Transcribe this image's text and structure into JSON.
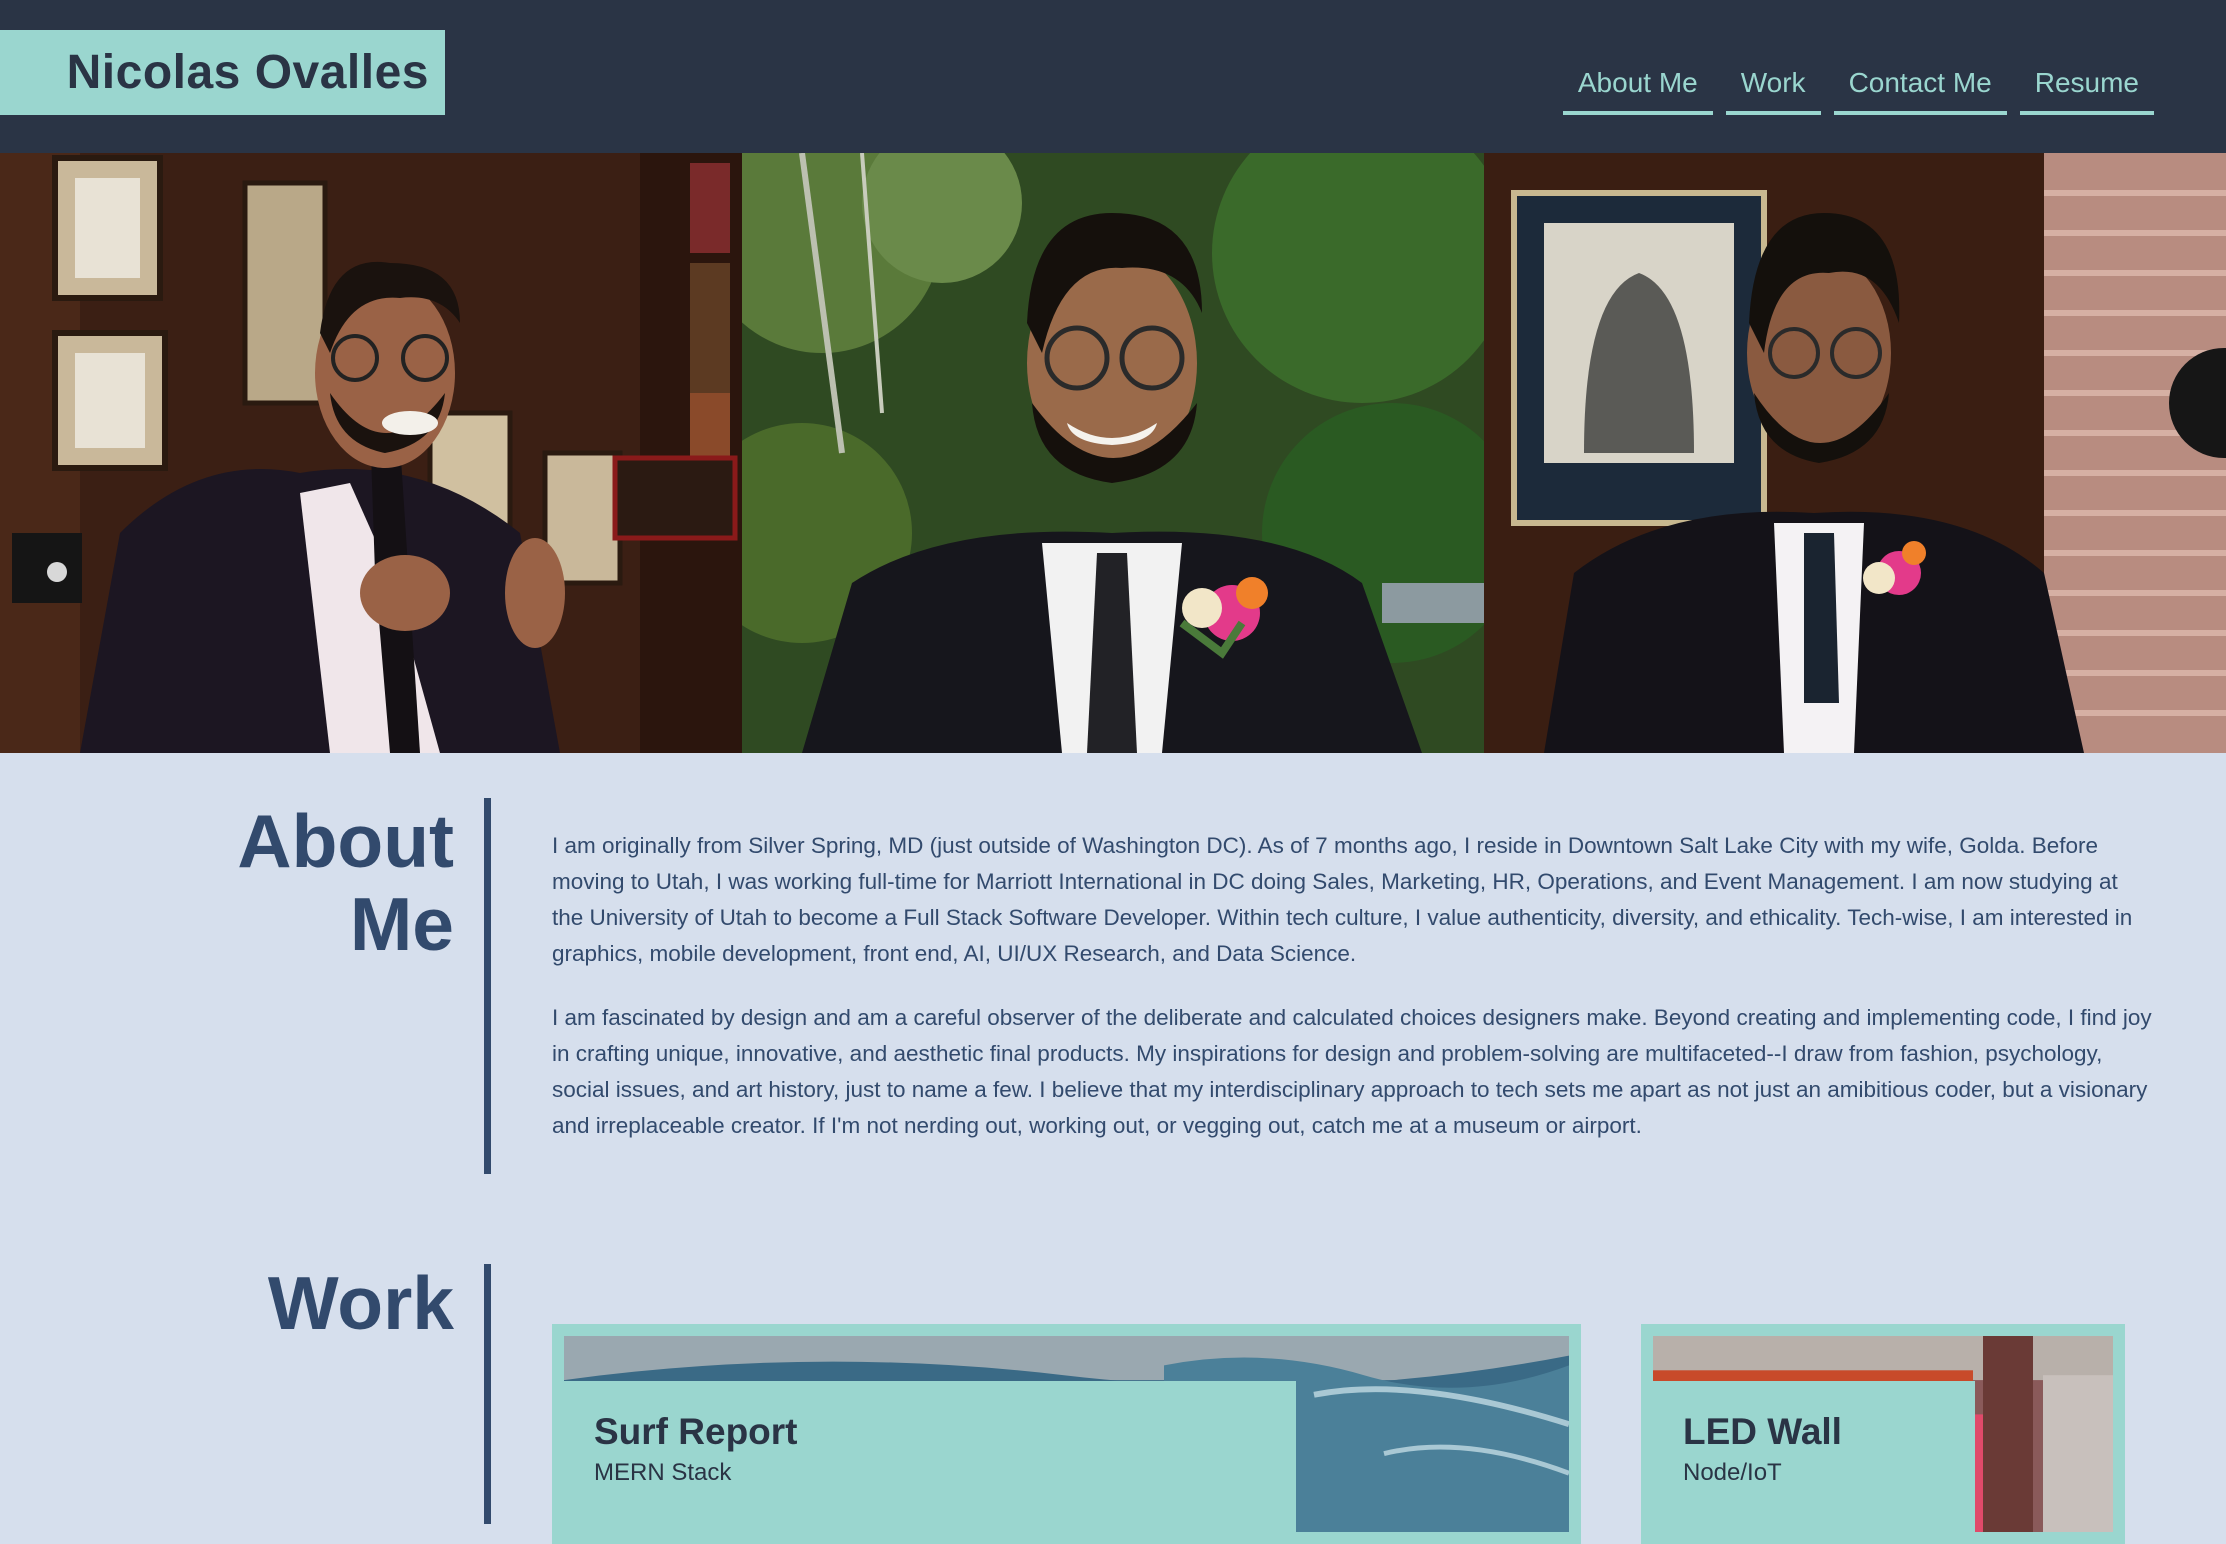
{
  "header": {
    "brand": "Nicolas Ovalles",
    "nav": [
      "About Me",
      "Work",
      "Contact Me",
      "Resume"
    ]
  },
  "hero": {
    "photos": [
      {
        "alt": "Nicolas in a suit in a wood-paneled library"
      },
      {
        "alt": "Nicolas smiling outdoors with a boutonniere"
      },
      {
        "alt": "Nicolas in a suit beside a framed portrait"
      }
    ]
  },
  "about": {
    "title_line1": "About",
    "title_line2": "Me",
    "paragraphs": [
      "I am originally from Silver Spring, MD (just outside of Washington DC). As of 7 months ago, I reside in Downtown Salt Lake City with my wife, Golda. Before moving to Utah, I was working full-time for Marriott International in DC doing Sales, Marketing, HR, Operations, and Event Management. I am now studying at the University of Utah to become a Full Stack Software Developer. Within tech culture, I value authenticity, diversity, and ethicality. Tech-wise, I am interested in graphics, mobile development, front end, AI, UI/UX Research, and Data Science.",
      "I am fascinated by design and am a careful observer of the deliberate and calculated choices designers make. Beyond creating and implementing code, I find joy in crafting unique, innovative, and aesthetic final products. My inspirations for design and problem-solving are multifaceted--I draw from fashion, psychology, social issues, and art history, just to name a few. I believe that my interdisciplinary approach to tech sets me apart as not just an amibitious coder, but a visionary and irreplaceable creator. If I'm not nerding out, working out, or vegging out, catch me at a museum or airport."
    ]
  },
  "work": {
    "title": "Work",
    "projects": [
      {
        "title": "Surf Report",
        "stack": "MERN Stack"
      },
      {
        "title": "LED Wall",
        "stack": "Node/IoT"
      }
    ]
  },
  "colors": {
    "header_bg": "#2a3445",
    "accent": "#9ad6cf",
    "page_bg": "#d6dfed",
    "heading": "#324a6d"
  }
}
